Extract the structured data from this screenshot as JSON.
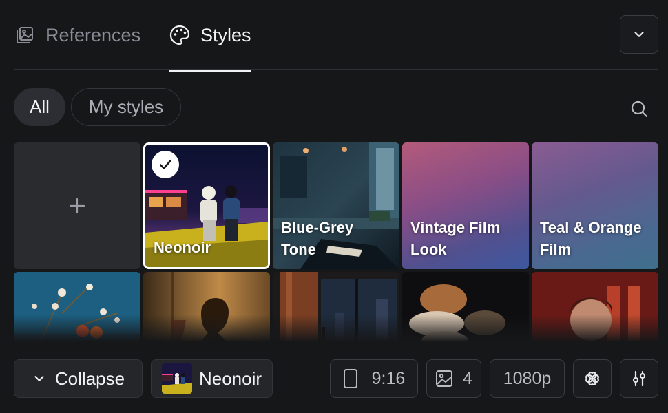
{
  "tabs": [
    {
      "label": "References",
      "icon": "image-stack-icon",
      "active": false
    },
    {
      "label": "Styles",
      "icon": "palette-icon",
      "active": true
    }
  ],
  "filters": [
    {
      "label": "All",
      "active": true
    },
    {
      "label": "My styles",
      "active": false
    }
  ],
  "grid": {
    "add_icon": "plus-icon",
    "selected_icon": "check-icon",
    "styles": [
      {
        "label": "Neonoir",
        "selected": true
      },
      {
        "label": "Blue-Grey Tone",
        "selected": false
      },
      {
        "label": "Vintage Film Look",
        "selected": false
      },
      {
        "label": "Teal & Orange Film",
        "selected": false
      }
    ]
  },
  "toolbar": {
    "collapse_label": "Collapse",
    "selected_style": "Neonoir",
    "aspect_ratio": "9:16",
    "image_count": "4",
    "resolution": "1080p"
  },
  "colors": {
    "background": "#161719",
    "surface": "#2a2b2f",
    "border": "#3a3c42",
    "text_primary": "#f2f3f5",
    "text_muted": "#8a8d96"
  }
}
